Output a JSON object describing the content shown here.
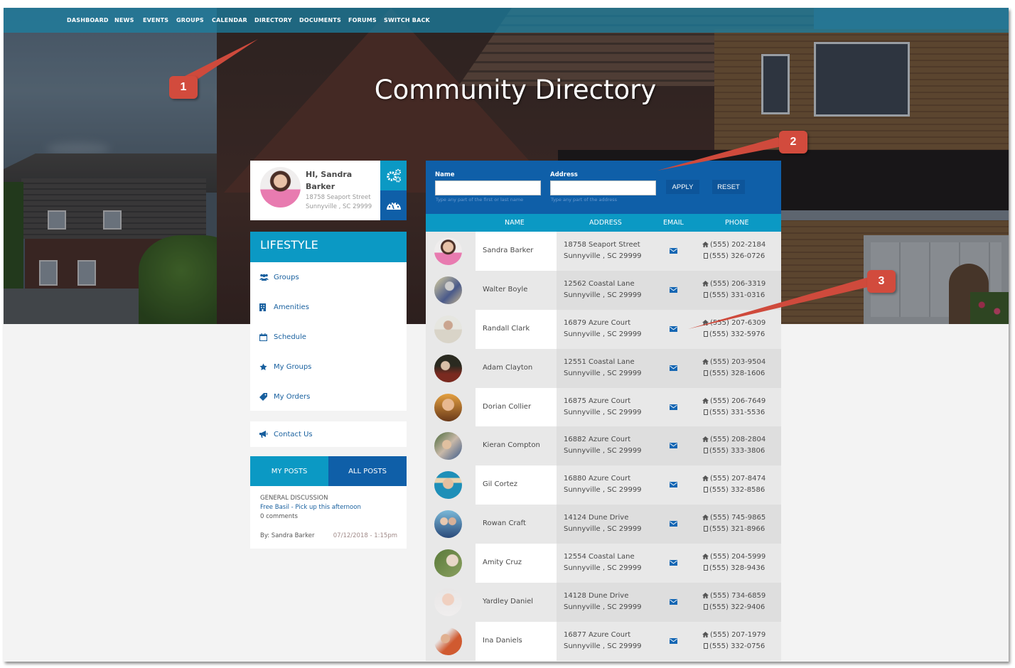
{
  "nav": {
    "items": [
      {
        "label": "DASHBOARD"
      },
      {
        "label": "NEWS"
      },
      {
        "label": "EVENTS"
      },
      {
        "label": "GROUPS"
      },
      {
        "label": "CALENDAR"
      },
      {
        "label": "DIRECTORY"
      },
      {
        "label": "DOCUMENTS"
      },
      {
        "label": "FORUMS"
      },
      {
        "label": "SWITCH BACK"
      }
    ]
  },
  "hero": {
    "title": "Community Directory"
  },
  "profile": {
    "greeting": "HI, Sandra Barker",
    "address_line1": "18758 Seaport Street",
    "address_line2": "Sunnyville , SC 29999",
    "settings_icon": "gears-icon",
    "dashboard_icon": "dashboard-gauge-icon"
  },
  "lifestyle": {
    "title": "LIFESTYLE",
    "items": [
      {
        "label": "Groups",
        "icon": "users-icon"
      },
      {
        "label": "Amenities",
        "icon": "building-icon"
      },
      {
        "label": "Schedule",
        "icon": "calendar-icon"
      },
      {
        "label": "My Groups",
        "icon": "star-icon"
      },
      {
        "label": "My Orders",
        "icon": "tag-icon"
      }
    ]
  },
  "contact": {
    "label": "Contact Us",
    "icon": "megaphone-icon"
  },
  "posts": {
    "tabs": [
      {
        "label": "MY POSTS"
      },
      {
        "label": "ALL POSTS"
      }
    ],
    "item": {
      "category": "GENERAL DISCUSSION",
      "title": "Free Basil - Pick up this afternoon",
      "comments": "0 comments",
      "author": "By: Sandra Barker",
      "date": "07/12/2018 - 1:15pm"
    }
  },
  "filter": {
    "name_label": "Name",
    "name_value": "",
    "name_help": "Type any part of the first or last name",
    "address_label": "Address",
    "address_value": "",
    "address_help": "Type any part of the address",
    "apply_label": "APPLY",
    "reset_label": "RESET"
  },
  "table": {
    "headers": [
      "NAME",
      "ADDRESS",
      "EMAIL",
      "PHONE"
    ],
    "rows": [
      {
        "name": "Sandra Barker",
        "address1": "18758 Seaport Street",
        "address2": "Sunnyville , SC 29999",
        "home": "(555) 202-2184",
        "mobile": "(555) 326-0726"
      },
      {
        "name": "Walter Boyle",
        "address1": "12562 Coastal Lane",
        "address2": "Sunnyville , SC 29999",
        "home": "(555) 206-3319",
        "mobile": "(555) 331-0316"
      },
      {
        "name": "Randall Clark",
        "address1": "16879 Azure Court",
        "address2": "Sunnyville , SC 29999",
        "home": "(555) 207-6309",
        "mobile": "(555) 332-5976"
      },
      {
        "name": "Adam Clayton",
        "address1": "12551 Coastal Lane",
        "address2": "Sunnyville , SC 29999",
        "home": "(555) 203-9504",
        "mobile": "(555) 328-1606"
      },
      {
        "name": "Dorian Collier",
        "address1": "16875 Azure Court",
        "address2": "Sunnyville , SC 29999",
        "home": "(555) 206-7649",
        "mobile": "(555) 331-5536"
      },
      {
        "name": "Kieran Compton",
        "address1": "16882 Azure Court",
        "address2": "Sunnyville , SC 29999",
        "home": "(555) 208-2804",
        "mobile": "(555) 333-3806"
      },
      {
        "name": "Gil Cortez",
        "address1": "16880 Azure Court",
        "address2": "Sunnyville , SC 29999",
        "home": "(555) 207-8474",
        "mobile": "(555) 332-8586"
      },
      {
        "name": "Rowan Craft",
        "address1": "14124 Dune Drive",
        "address2": "Sunnyville , SC 29999",
        "home": "(555) 745-9865",
        "mobile": "(555) 321-8966"
      },
      {
        "name": "Amity Cruz",
        "address1": "12554 Coastal Lane",
        "address2": "Sunnyville , SC 29999",
        "home": "(555) 204-5999",
        "mobile": "(555) 328-9436"
      },
      {
        "name": "Yardley Daniel",
        "address1": "14128 Dune Drive",
        "address2": "Sunnyville , SC 29999",
        "home": "(555) 734-6859",
        "mobile": "(555) 322-9406"
      },
      {
        "name": "Ina Daniels",
        "address1": "16877 Azure Court",
        "address2": "Sunnyville , SC 29999",
        "home": "(555) 207-1979",
        "mobile": "(555) 332-0756"
      }
    ]
  },
  "callouts": [
    {
      "label": "1"
    },
    {
      "label": "2"
    },
    {
      "label": "3"
    }
  ],
  "colors": {
    "accent_cyan": "#0b99c4",
    "accent_blue": "#0f5fa8",
    "callout_red": "#d24b3d",
    "link_blue": "#175f9e"
  }
}
